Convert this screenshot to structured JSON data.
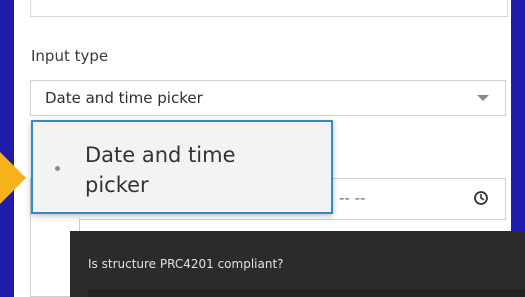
{
  "form": {
    "input_type_label": "Input type",
    "selected_value": "Date and time picker",
    "behind_placeholder": "-- --"
  },
  "dropdown": {
    "options": [
      {
        "label": "Date and time picker"
      }
    ]
  },
  "tooltip": {
    "text": "Is structure PRC4201 compliant?"
  },
  "colors": {
    "background": "#1e1ca8",
    "highlight_border": "#2f8cc7",
    "pointer": "#f5b21b",
    "tooltip_bg": "#2b2b2b"
  }
}
